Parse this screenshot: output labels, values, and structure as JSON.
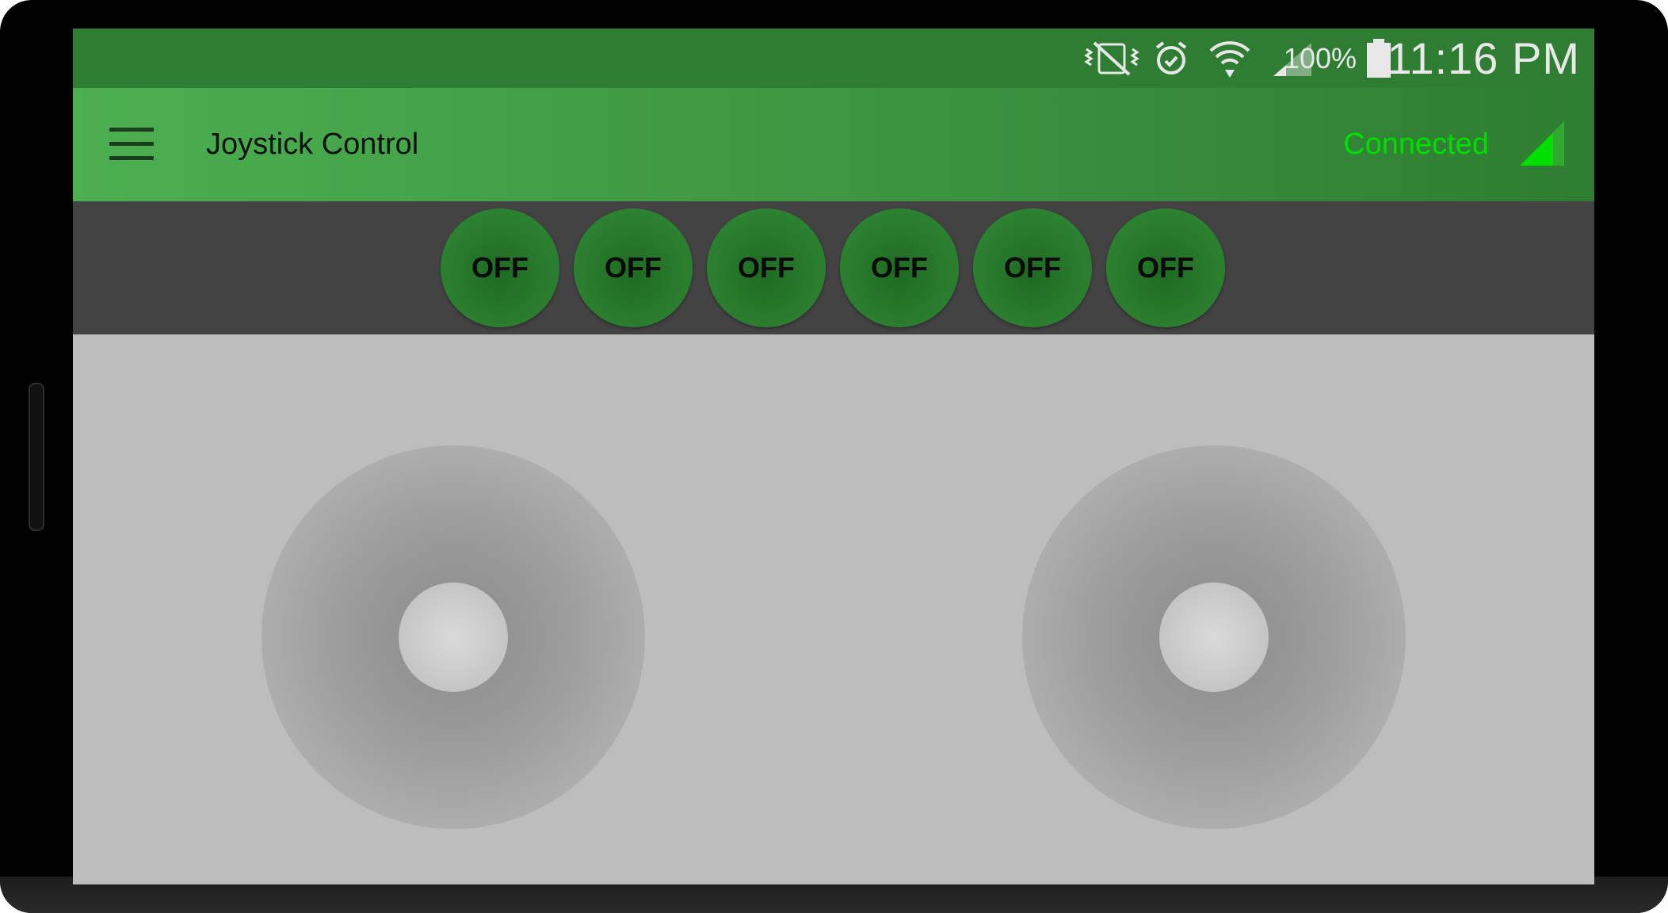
{
  "status_bar": {
    "battery_percent": "100%",
    "time": "11:16 PM",
    "icons": [
      "vibrate-mute-icon",
      "alarm-icon",
      "wifi-icon",
      "cell-signal-icon",
      "battery-icon"
    ]
  },
  "app_bar": {
    "title": "Joystick Control",
    "connection_status": "Connected",
    "connection_color": "#00e000",
    "menu_icon": "hamburger-menu-icon",
    "status_icon": "signal-strength-icon"
  },
  "toggles": [
    {
      "label": "OFF"
    },
    {
      "label": "OFF"
    },
    {
      "label": "OFF"
    },
    {
      "label": "OFF"
    },
    {
      "label": "OFF"
    },
    {
      "label": "OFF"
    }
  ],
  "joysticks": [
    {
      "name": "left-joystick"
    },
    {
      "name": "right-joystick"
    }
  ],
  "colors": {
    "status_bar": "#2e7d32",
    "app_bar_start": "#4caf50",
    "app_bar_end": "#2e7d32",
    "toggle_bar": "#434343",
    "background": "#bdbdbd"
  }
}
